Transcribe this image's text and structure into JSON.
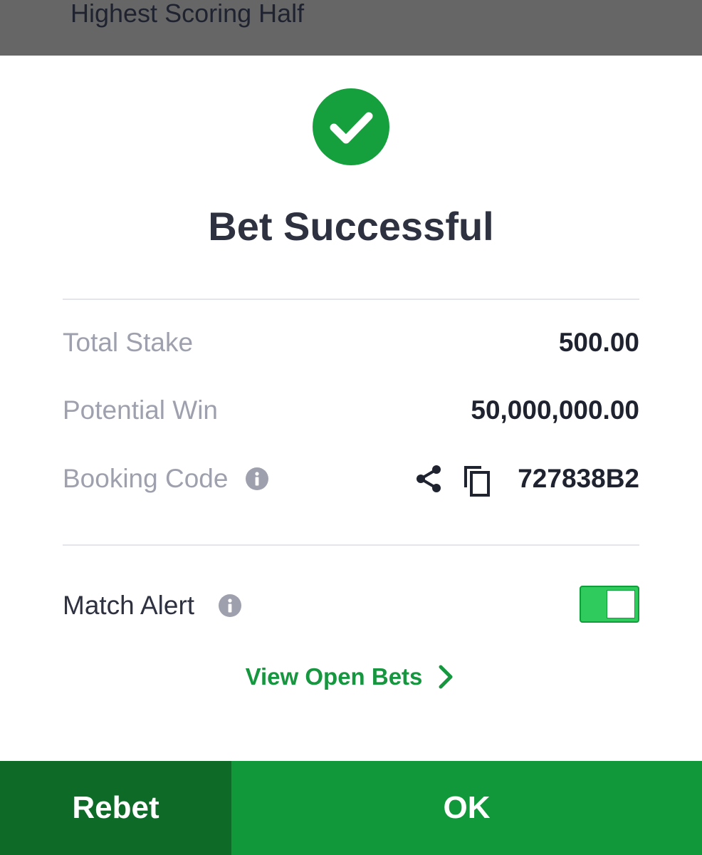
{
  "header": {
    "title": "Highest Scoring Half"
  },
  "dialog": {
    "title": "Bet Successful",
    "status_icon": "check-circle-icon",
    "total_stake": {
      "label": "Total Stake",
      "value": "500.00"
    },
    "potential_win": {
      "label": "Potential Win",
      "value": "50,000,000.00"
    },
    "booking_code": {
      "label": "Booking Code",
      "value": "727838B2",
      "icons": [
        "info-icon",
        "share-icon",
        "copy-icon"
      ]
    },
    "match_alert": {
      "label": "Match Alert",
      "enabled": true
    },
    "view_open_bets": {
      "label": "View Open Bets"
    }
  },
  "actions": {
    "rebet_label": "Rebet",
    "ok_label": "OK"
  },
  "colors": {
    "brand_green": "#10983a",
    "dark_green": "#0d6b27",
    "toggle_green": "#2fcb5c",
    "overlay_gray": "#666666",
    "title_text": "#2e3140",
    "muted_text": "#9ea1ad"
  }
}
